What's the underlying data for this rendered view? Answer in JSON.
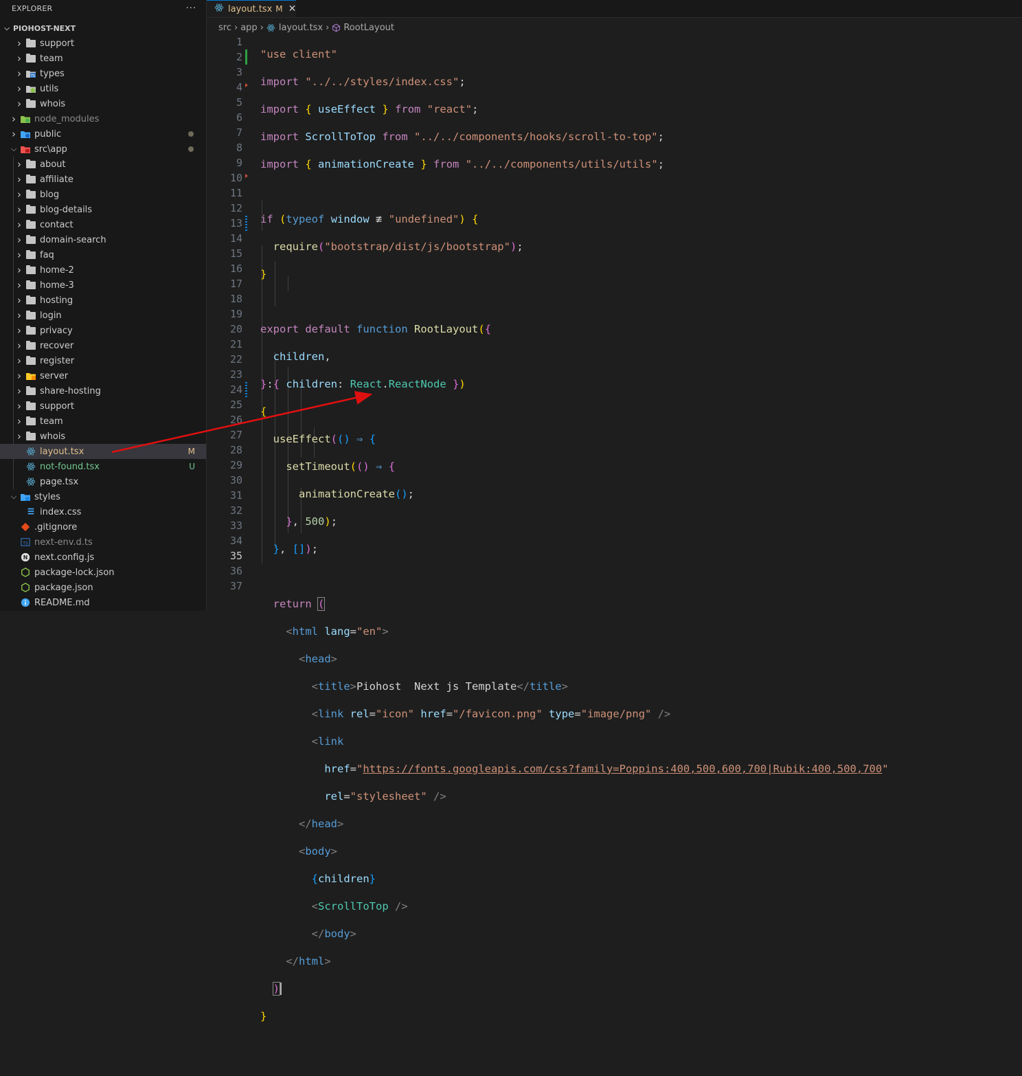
{
  "explorer": {
    "title": "EXPLORER",
    "more": "···",
    "root": "PIOHOST-NEXT",
    "items": [
      {
        "label": "support",
        "kind": "folder",
        "depth": 1
      },
      {
        "label": "team",
        "kind": "folder",
        "depth": 1
      },
      {
        "label": "types",
        "kind": "folder-ts",
        "depth": 1
      },
      {
        "label": "utils",
        "kind": "folder-green",
        "depth": 1
      },
      {
        "label": "whois",
        "kind": "folder",
        "depth": 1
      },
      {
        "label": "node_modules",
        "kind": "folder-node",
        "depth": 0,
        "dim": true
      },
      {
        "label": "public",
        "kind": "folder-public",
        "depth": 0,
        "dot": true
      },
      {
        "label": "src\\app",
        "kind": "folder-src",
        "depth": 0,
        "open": true,
        "dot": true
      },
      {
        "label": "about",
        "kind": "folder",
        "depth": 1
      },
      {
        "label": "affiliate",
        "kind": "folder",
        "depth": 1
      },
      {
        "label": "blog",
        "kind": "folder",
        "depth": 1
      },
      {
        "label": "blog-details",
        "kind": "folder",
        "depth": 1
      },
      {
        "label": "contact",
        "kind": "folder",
        "depth": 1
      },
      {
        "label": "domain-search",
        "kind": "folder",
        "depth": 1
      },
      {
        "label": "faq",
        "kind": "folder",
        "depth": 1
      },
      {
        "label": "home-2",
        "kind": "folder",
        "depth": 1
      },
      {
        "label": "home-3",
        "kind": "folder",
        "depth": 1
      },
      {
        "label": "hosting",
        "kind": "folder",
        "depth": 1
      },
      {
        "label": "login",
        "kind": "folder",
        "depth": 1
      },
      {
        "label": "privacy",
        "kind": "folder",
        "depth": 1
      },
      {
        "label": "recover",
        "kind": "folder",
        "depth": 1
      },
      {
        "label": "register",
        "kind": "folder",
        "depth": 1
      },
      {
        "label": "server",
        "kind": "folder-yellow",
        "depth": 1
      },
      {
        "label": "share-hosting",
        "kind": "folder",
        "depth": 1
      },
      {
        "label": "support",
        "kind": "folder",
        "depth": 1
      },
      {
        "label": "team",
        "kind": "folder",
        "depth": 1
      },
      {
        "label": "whois",
        "kind": "folder",
        "depth": 1
      },
      {
        "label": "layout.tsx",
        "kind": "react",
        "depth": 1,
        "status": "M",
        "color": "#e2c08d",
        "selected": true
      },
      {
        "label": "not-found.tsx",
        "kind": "react",
        "depth": 1,
        "status": "U",
        "color": "#73c991"
      },
      {
        "label": "page.tsx",
        "kind": "react",
        "depth": 1
      },
      {
        "label": "styles",
        "kind": "folder-styles",
        "depth": 0,
        "open": true
      },
      {
        "label": "index.css",
        "kind": "css",
        "depth": 1
      },
      {
        "label": ".gitignore",
        "kind": "git",
        "depth": 0
      },
      {
        "label": "next-env.d.ts",
        "kind": "ts",
        "depth": 0,
        "dim": true
      },
      {
        "label": "next.config.js",
        "kind": "next",
        "depth": 0
      },
      {
        "label": "package-lock.json",
        "kind": "npm",
        "depth": 0
      },
      {
        "label": "package.json",
        "kind": "npm",
        "depth": 0
      },
      {
        "label": "README.md",
        "kind": "info",
        "depth": 0
      }
    ]
  },
  "tab": {
    "name": "layout.tsx",
    "modified": "M",
    "close": "✕"
  },
  "breadcrumb": [
    "src",
    "app",
    "layout.tsx",
    "RootLayout"
  ],
  "editor": {
    "current_line": 35,
    "line_numbers": [
      "1",
      "2",
      "3",
      "4",
      "5",
      "6",
      "7",
      "8",
      "9",
      "10",
      "11",
      "12",
      "13",
      "14",
      "15",
      "16",
      "17",
      "18",
      "19",
      "20",
      "21",
      "22",
      "23",
      "24",
      "25",
      "26",
      "27",
      "28",
      "29",
      "30",
      "31",
      "32",
      "33",
      "34",
      "35",
      "36",
      "37"
    ]
  },
  "colors": {
    "accent": "#0078d4",
    "modified": "#e2c08d",
    "untracked": "#73c991",
    "annotation_arrow": "#e01010"
  }
}
